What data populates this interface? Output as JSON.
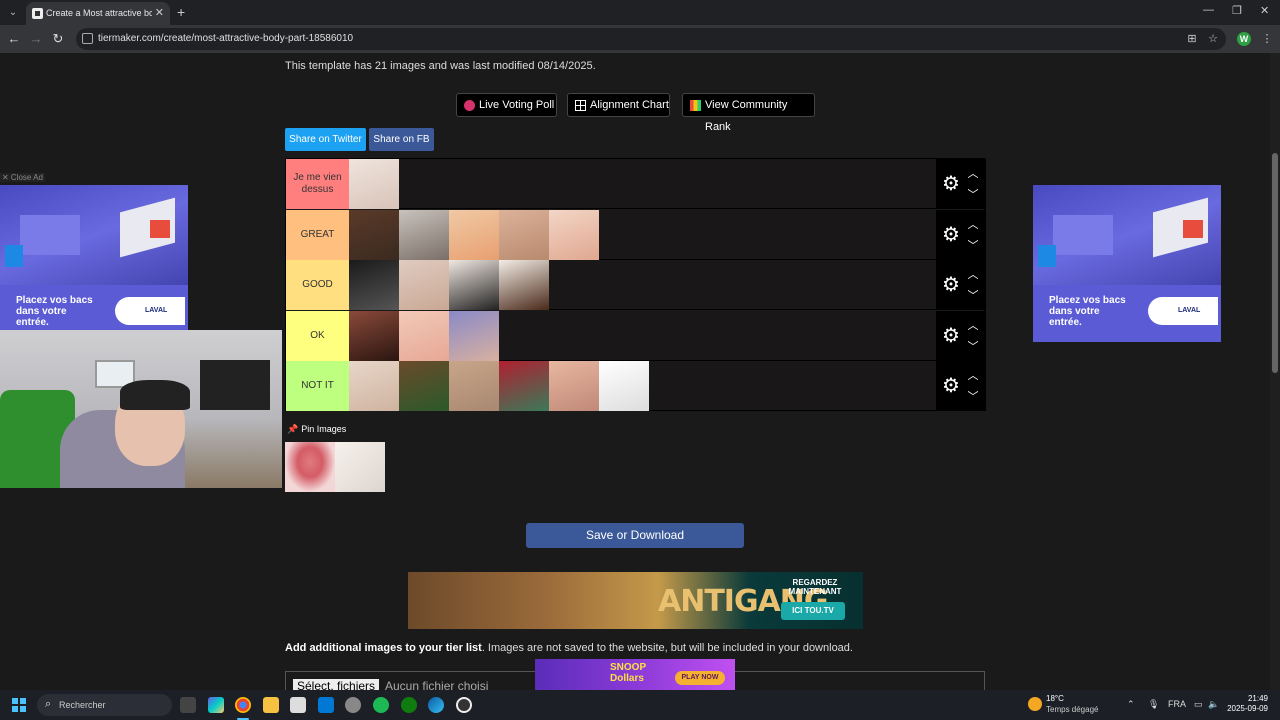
{
  "browser": {
    "tab_title": "Create a Most attractive body p",
    "url": "tiermaker.com/create/most-attractive-body-part-18586010",
    "profile_initial": "W"
  },
  "page": {
    "template_info": "This template has 21 images and was last modified 08/14/2025.",
    "buttons": {
      "live_voting": "Live Voting Poll",
      "alignment_chart": "Alignment Chart",
      "community_rank": "View Community Rank"
    },
    "share": {
      "twitter": "Share on Twitter",
      "facebook": "Share on FB"
    },
    "tiers": [
      {
        "label": "Je me vien dessus",
        "color": "#ff7f7f",
        "count": 1
      },
      {
        "label": "GREAT",
        "color": "#ffbf7f",
        "count": 5
      },
      {
        "label": "GOOD",
        "color": "#ffdf7f",
        "count": 4
      },
      {
        "label": "OK",
        "color": "#ffff7f",
        "count": 3
      },
      {
        "label": "NOT IT",
        "color": "#bfff7f",
        "count": 6
      }
    ],
    "pin_label": "Pin Images",
    "pin_count": 2,
    "save_label": "Save or Download",
    "add_images_bold": "Add additional images to your tier list",
    "add_images_rest": ". Images are not saved to the website, but will be included in your download.",
    "file_button": "Sélect. fichiers",
    "file_status": "Aucun fichier choisi"
  },
  "ads": {
    "side_text_line1": "Placez vos bacs",
    "side_text_line2": "dans votre",
    "side_text_line3": "entrée.",
    "laval": "LAVAL",
    "close_ad": "✕ Close Ad",
    "banner_title": "ANTIGANG",
    "banner_cta_line1": "REGARDEZ",
    "banner_cta_line2": "MAINTENANT",
    "banner_logo": "ICI TOU.TV",
    "snoop_line1": "SNOOP",
    "snoop_line2": "Dollars",
    "snoop_play": "PLAY NOW"
  },
  "taskbar": {
    "search": "Rechercher",
    "temp": "18°C",
    "weather": "Temps dégagé",
    "lang": "FRA",
    "time": "21:49",
    "date": "2025-09-09"
  }
}
